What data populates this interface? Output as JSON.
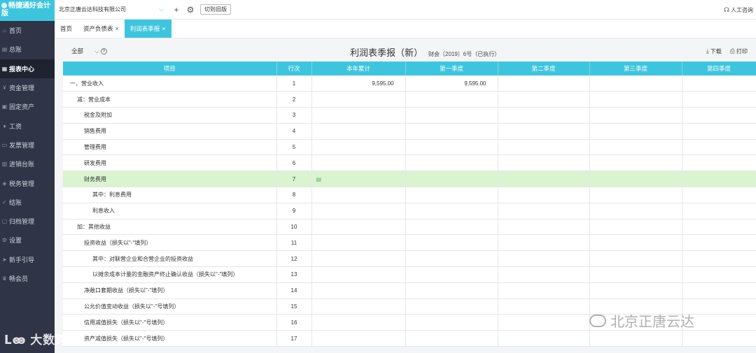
{
  "app": {
    "brand_text": "畅捷通好会计",
    "brand_line2": "版"
  },
  "sidebar": {
    "items": [
      {
        "label": "首页",
        "icon": "home-icon",
        "active": false
      },
      {
        "label": "总账",
        "icon": "ledger-icon",
        "active": false
      },
      {
        "label": "报表中心",
        "icon": "report-icon",
        "active": true
      },
      {
        "label": "资金管理",
        "icon": "fund-icon",
        "active": false
      },
      {
        "label": "固定资产",
        "icon": "asset-icon",
        "active": false
      },
      {
        "label": "工资",
        "icon": "salary-icon",
        "active": false
      },
      {
        "label": "发票管理",
        "icon": "invoice-icon",
        "active": false
      },
      {
        "label": "进销台账",
        "icon": "inventory-icon",
        "active": false
      },
      {
        "label": "税务管理",
        "icon": "tax-icon",
        "active": false
      },
      {
        "label": "结账",
        "icon": "closing-icon",
        "active": false
      },
      {
        "label": "归档管理",
        "icon": "archive-icon",
        "active": false
      },
      {
        "label": "设置",
        "icon": "settings-icon",
        "active": false
      },
      {
        "label": "新手引导",
        "icon": "guide-icon",
        "active": false
      },
      {
        "label": "畅会员",
        "icon": "member-icon",
        "active": false
      }
    ]
  },
  "topbar": {
    "company": "北京正唐云达科技有限公司",
    "switch_label": "切到旧版",
    "support_label": "人工咨询"
  },
  "tabs": [
    {
      "label": "首页",
      "closable": false,
      "active": false
    },
    {
      "label": "资产负债表",
      "closable": true,
      "active": false
    },
    {
      "label": "利润表季报",
      "closable": true,
      "active": true
    }
  ],
  "toolbar": {
    "filter_value": "全部",
    "title": "利润表季报（新）",
    "subtitle": "财会〔2019〕6号（已执行）",
    "download_label": "下载",
    "print_label": "打印"
  },
  "table": {
    "headers": [
      "项目",
      "行次",
      "本年累计",
      "第一季度",
      "第二季度",
      "第三季度",
      "第四季度"
    ],
    "rows": [
      {
        "item": "一、营业收入",
        "line": "1",
        "ytd": "9,595.00",
        "q1": "9,595.00",
        "q2": "",
        "q3": "",
        "q4": "",
        "level": 0
      },
      {
        "item": "减：营业成本",
        "line": "2",
        "ytd": "",
        "q1": "",
        "q2": "",
        "q3": "",
        "q4": "",
        "level": 1
      },
      {
        "item": "税金及附加",
        "line": "3",
        "ytd": "",
        "q1": "",
        "q2": "",
        "q3": "",
        "q4": "",
        "level": 2
      },
      {
        "item": "销售费用",
        "line": "4",
        "ytd": "",
        "q1": "",
        "q2": "",
        "q3": "",
        "q4": "",
        "level": 2
      },
      {
        "item": "管理费用",
        "line": "5",
        "ytd": "",
        "q1": "",
        "q2": "",
        "q3": "",
        "q4": "",
        "level": 2
      },
      {
        "item": "研发费用",
        "line": "6",
        "ytd": "",
        "q1": "",
        "q2": "",
        "q3": "",
        "q4": "",
        "level": 2
      },
      {
        "item": "财务费用",
        "line": "7",
        "ytd": "",
        "q1": "",
        "q2": "",
        "q3": "",
        "q4": "",
        "level": 2,
        "highlight": true
      },
      {
        "item": "其中：利息费用",
        "line": "8",
        "ytd": "",
        "q1": "",
        "q2": "",
        "q3": "",
        "q4": "",
        "level": 3
      },
      {
        "item": "利息收入",
        "line": "9",
        "ytd": "",
        "q1": "",
        "q2": "",
        "q3": "",
        "q4": "",
        "level": 3
      },
      {
        "item": "加：其他收益",
        "line": "10",
        "ytd": "",
        "q1": "",
        "q2": "",
        "q3": "",
        "q4": "",
        "level": 1
      },
      {
        "item": "投资收益（损失以\"-\"填列）",
        "line": "11",
        "ytd": "",
        "q1": "",
        "q2": "",
        "q3": "",
        "q4": "",
        "level": 2
      },
      {
        "item": "其中：对联营企业和合营企业的投资收益",
        "line": "12",
        "ytd": "",
        "q1": "",
        "q2": "",
        "q3": "",
        "q4": "",
        "level": 3
      },
      {
        "item": "以摊余成本计量的金融资产终止确认收益（损失以\"-\"填列）",
        "line": "13",
        "ytd": "",
        "q1": "",
        "q2": "",
        "q3": "",
        "q4": "",
        "level": 3
      },
      {
        "item": "净敞口套期收益（损失以\"-\"填列）",
        "line": "14",
        "ytd": "",
        "q1": "",
        "q2": "",
        "q3": "",
        "q4": "",
        "level": 2
      },
      {
        "item": "公允价值变动收益（损失以\"-\"号填列）",
        "line": "15",
        "ytd": "",
        "q1": "",
        "q2": "",
        "q3": "",
        "q4": "",
        "level": 2
      },
      {
        "item": "信用减值损失（损失以\"-\"号填列）",
        "line": "16",
        "ytd": "",
        "q1": "",
        "q2": "",
        "q3": "",
        "q4": "",
        "level": 2
      },
      {
        "item": "资产减值损失（损失以\"-\"号填列）",
        "line": "17",
        "ytd": "",
        "q1": "",
        "q2": "",
        "q3": "",
        "q4": "",
        "level": 2
      }
    ]
  },
  "watermarks": {
    "left": "大数跨境",
    "right": "北京正唐云达"
  },
  "colors": {
    "accent": "#3ec5de",
    "sidebar_bg": "#2f3447",
    "highlight_row": "#d9f4cf"
  }
}
